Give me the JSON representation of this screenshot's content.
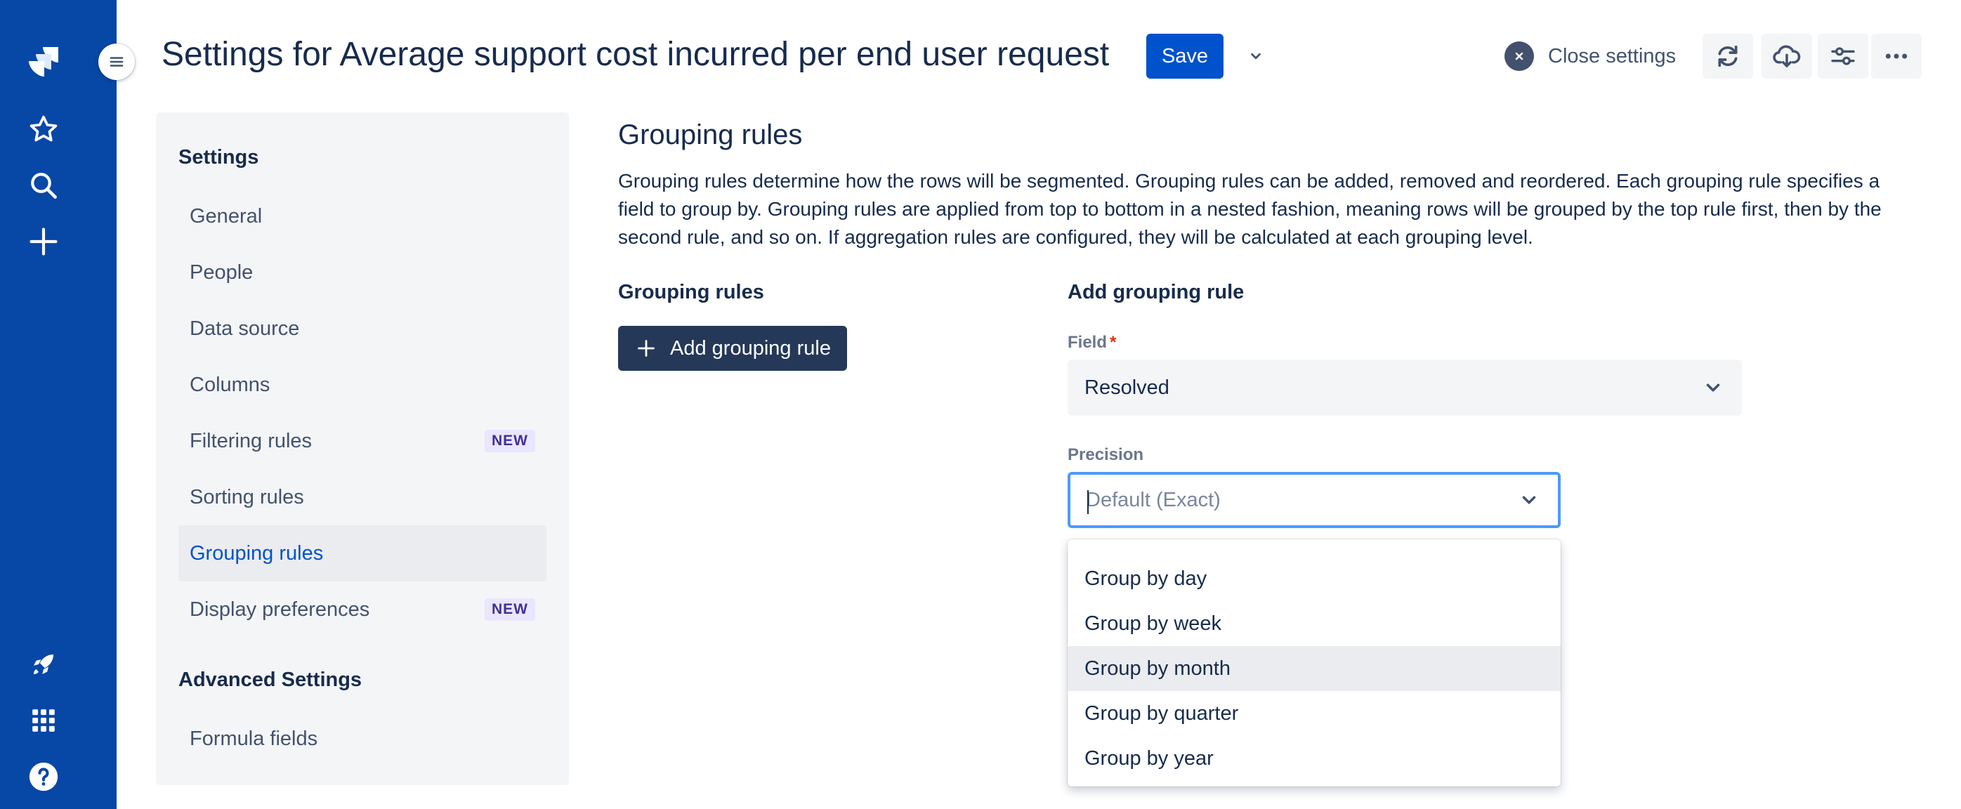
{
  "header": {
    "title": "Settings for Average support cost incurred per end user request",
    "save_label": "Save",
    "close_label": "Close settings"
  },
  "global_nav": {
    "icons": [
      "jira-logo-icon",
      "star-icon",
      "search-icon",
      "plus-icon",
      "rocket-icon",
      "app-grid-icon",
      "help-icon"
    ]
  },
  "settings_nav": {
    "heading": "Settings",
    "items": [
      {
        "label": "General"
      },
      {
        "label": "People"
      },
      {
        "label": "Data source"
      },
      {
        "label": "Columns"
      },
      {
        "label": "Filtering rules",
        "badge": "NEW"
      },
      {
        "label": "Sorting rules"
      },
      {
        "label": "Grouping rules",
        "active": true
      },
      {
        "label": "Display preferences",
        "badge": "NEW"
      }
    ],
    "advanced_heading": "Advanced Settings",
    "advanced_items": [
      {
        "label": "Formula fields"
      }
    ]
  },
  "main": {
    "title": "Grouping rules",
    "description": "Grouping rules determine how the rows will be segmented. Grouping rules can be added, removed and reordered. Each grouping rule specifies a field to group by. Grouping rules are applied from top to bottom in a nested fashion, meaning rows will be grouped by the top rule first, then by the second rule, and so on. If aggregation rules are configured, they will be calculated at each grouping level.",
    "rules_heading": "Grouping rules",
    "add_button_label": "Add grouping rule",
    "add_rule_heading": "Add grouping rule",
    "field_label": "Field",
    "field_required_marker": "*",
    "field_value": "Resolved",
    "precision_label": "Precision",
    "precision_placeholder": "Default (Exact)",
    "precision_options": [
      "Group by day",
      "Group by week",
      "Group by month",
      "Group by quarter",
      "Group by year"
    ],
    "hovered_option": "Group by month"
  },
  "colors": {
    "nav_bg": "#0747a6",
    "primary": "#0052cc",
    "dark_button": "#253858",
    "focus_border": "#4c9aff",
    "badge_bg": "#eae6ff",
    "badge_text": "#403294"
  }
}
